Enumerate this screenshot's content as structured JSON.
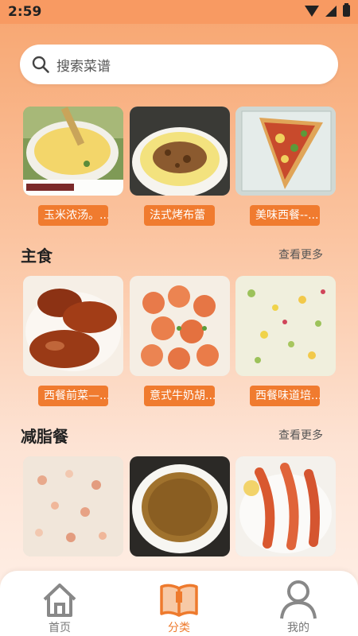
{
  "status": {
    "time": "2:59"
  },
  "search": {
    "placeholder": "搜索菜谱"
  },
  "row1": {
    "items": [
      {
        "label": "玉米浓汤。..."
      },
      {
        "label": "法式烤布蕾"
      },
      {
        "label": "美味西餐--..."
      }
    ]
  },
  "staple": {
    "title": "主食",
    "more": "查看更多",
    "items": [
      {
        "label": "西餐前菜—..."
      },
      {
        "label": "意式牛奶胡..."
      },
      {
        "label": "西餐味道培..."
      }
    ]
  },
  "diet": {
    "title": "减脂餐",
    "more": "查看更多"
  },
  "nav": {
    "items": [
      {
        "label": "首页",
        "icon": "home-icon"
      },
      {
        "label": "分类",
        "icon": "book-icon"
      },
      {
        "label": "我的",
        "icon": "user-icon"
      }
    ]
  },
  "colors": {
    "accent": "#f07b2f",
    "header": "#f89a62"
  }
}
